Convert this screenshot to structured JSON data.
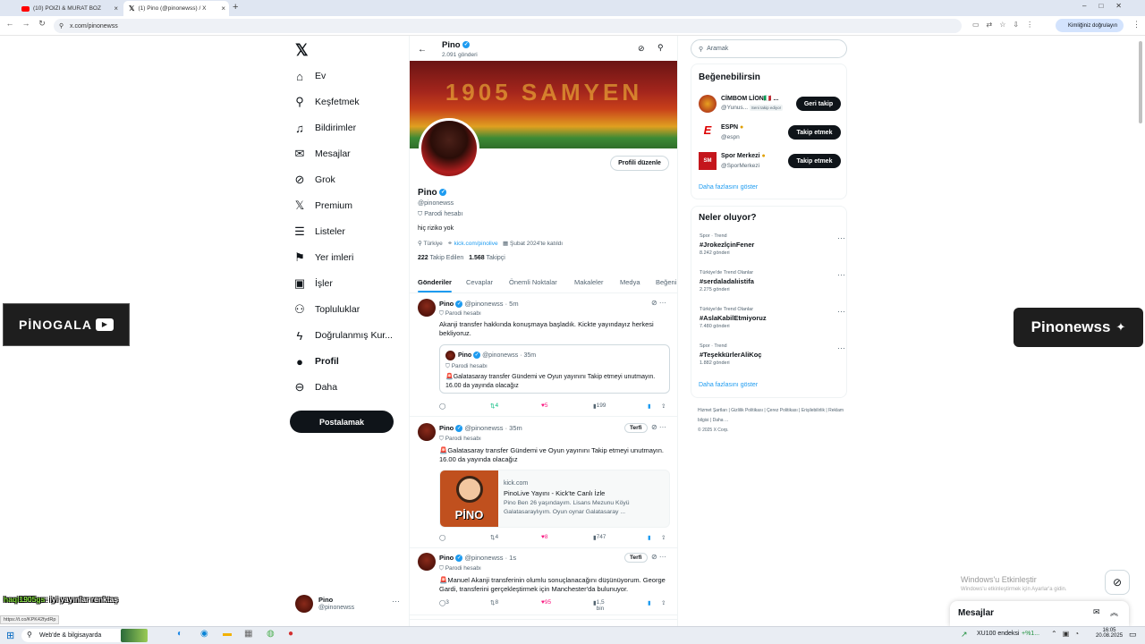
{
  "browser": {
    "tabs": [
      {
        "label": "(10) POIZI & MURAT BOZ"
      },
      {
        "label": "(1) Pino (@pinonewss) / X"
      }
    ],
    "url": "x.com/pinonewss",
    "profile_chip": "Kimliğiniz doğrulayın",
    "status_url": "https://t.co/KPK42fydRp"
  },
  "nav": {
    "items": [
      {
        "label": "Ev"
      },
      {
        "label": "Keşfetmek"
      },
      {
        "label": "Bildirimler"
      },
      {
        "label": "Mesajlar"
      },
      {
        "label": "Grok"
      },
      {
        "label": "Premium"
      },
      {
        "label": "Listeler"
      },
      {
        "label": "Yer imleri"
      },
      {
        "label": "İşler"
      },
      {
        "label": "Topluluklar"
      },
      {
        "label": "Doğrulanmış Kur..."
      },
      {
        "label": "Profil"
      },
      {
        "label": "Daha"
      }
    ],
    "post_label": "Postalamak",
    "account": {
      "name": "Pino",
      "handle": "@pinonewss"
    }
  },
  "header": {
    "name": "Pino",
    "posts": "2.091 gönderi"
  },
  "banner_text": "1905 SAMYEN",
  "profile": {
    "edit_label": "Profili düzenle",
    "name": "Pino",
    "handle": "@pinonewss",
    "parody": "Parodi hesabı",
    "bio": "hiç riziko yok",
    "location": "Türkiye",
    "link": "kick.com/pinolive",
    "joined": "Şubat 2024'te katıldı",
    "following_count": "222",
    "following_label": "Takip Edilen",
    "followers_count": "1.568",
    "followers_label": "Takipçi"
  },
  "tabs": [
    {
      "label": "Gönderiler"
    },
    {
      "label": "Cevaplar"
    },
    {
      "label": "Önemli Noktalar"
    },
    {
      "label": "Makaleler"
    },
    {
      "label": "Medya"
    },
    {
      "label": "Beğeni"
    }
  ],
  "tweets": [
    {
      "name": "Pino",
      "handle": "@pinonewss · 5m",
      "parody": "Parodi hesabı",
      "text": "Akanji transfer hakkında konuşmaya başladık. Kickte yayındayız herkesi bekliyoruz.",
      "quote": {
        "name": "Pino",
        "handle": "@pinonewss · 35m",
        "parody": "Parodi hesabı",
        "text": "🚨Galatasaray transfer Gündemi ve Oyun yayınını Takip etmeyi unutmayın. 16.00 da yayında olacağız"
      },
      "replies": "",
      "retweets": "4",
      "likes": "5",
      "views": "199"
    },
    {
      "name": "Pino",
      "handle": "@pinonewss · 35m",
      "promote": "Terfi",
      "parody": "Parodi hesabı",
      "text": "🚨Galatasaray transfer Gündemi ve Oyun yayınını Takip etmeyi unutmayın. 16.00 da yayında olacağız",
      "card": {
        "domain": "kick.com",
        "title": "PinoLive Yayını - Kick'te Canlı İzle",
        "desc": "Pino Ben 26 yaşındayım. Lisans Mezunu Köyü Galatasaraylıyım. Oyun oynar Galatasaray ...",
        "logo": "PİNO"
      },
      "replies": "",
      "retweets": "4",
      "likes": "8",
      "views": "747"
    },
    {
      "name": "Pino",
      "handle": "@pinonewss · 1s",
      "promote": "Terfi",
      "parody": "Parodi hesabı",
      "text": "🚨Manuel Akanji transferinin olumlu sonuçlanacağını düşünüyorum. George Gardi, transferini gerçekleştirmek için Manchester'da bulunuyor.",
      "replies": "3",
      "retweets": "8",
      "likes": "95",
      "views": "1,5 bin"
    }
  ],
  "right": {
    "search_placeholder": "Aramak",
    "who_title": "Beğenebilirsin",
    "who": [
      {
        "name": "CİMBOM LİON🇮🇹 ...",
        "handle": "@Yunus...",
        "badge": "Seni takip ediyor",
        "btn": "Geri takip"
      },
      {
        "name": "ESPN",
        "handle": "@espn",
        "btn": "Takip etmek"
      },
      {
        "name": "Spor Merkezi",
        "handle": "@SporMerkezi",
        "btn": "Takip etmek"
      }
    ],
    "show_more": "Daha fazlasını göster",
    "trends_title": "Neler oluyor?",
    "trends": [
      {
        "cat": "Spor · Trend",
        "tag": "#JrokezİçinFener",
        "count": "8.242 gönderi"
      },
      {
        "cat": "Türkiye'de Trend Olanlar",
        "tag": "#serdaladalıistifa",
        "count": "2.275 gönderi"
      },
      {
        "cat": "Türkiye'de Trend Olanlar",
        "tag": "#AslaKabilEtmiyoruz",
        "count": "7.480 gönderi"
      },
      {
        "cat": "Spor · Trend",
        "tag": "#TeşekkürlerAliKoç",
        "count": "1.882 gönderi"
      }
    ],
    "footer": [
      "Hizmet Şartları",
      "Gizlilik Politikası",
      "Çerez Politikası",
      "Erişilebilirlik",
      "Reklam bilgisi",
      "Daha ...",
      "© 2025 X Corp."
    ]
  },
  "overlays": {
    "left_logo": "PİNOGALA",
    "right_logo": "Pinonewss",
    "chat": "haqi1905gs",
    "chat_msg": ": iyi yayınlar renktaş",
    "activate_title": "Windows'u Etkinleştir",
    "activate_sub": "Windows'u etkinleştirmek için Ayarlar'a gidin.",
    "messages_label": "Mesajlar"
  },
  "taskbar": {
    "search": "Web'de & bilgisayarda",
    "ticker": "XU100 endeksi",
    "ticker_val": "+%1...",
    "time": "16:05",
    "date": "20.08.2025"
  }
}
